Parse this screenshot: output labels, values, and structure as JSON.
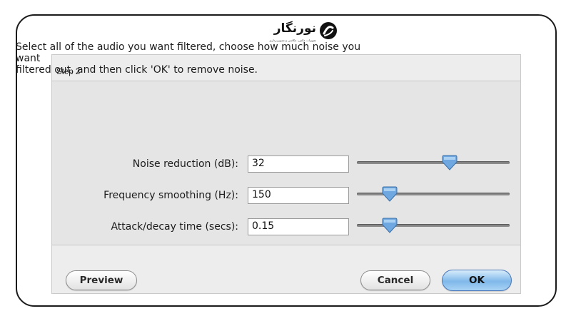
{
  "logo": {
    "text": "نورنگار",
    "subtitle": "تجهیزات عکس، عکاسی و تصویربرداری"
  },
  "dialog": {
    "step_label": "Step 2",
    "instructions": {
      "line1": "Select all of the audio you want filtered, choose how much noise you",
      "line2": "want",
      "line3": "filtered out, and then click 'OK' to remove noise."
    },
    "controls": [
      {
        "label": "Noise reduction (dB):",
        "value": "32",
        "slider_fraction": 0.62
      },
      {
        "label": "Frequency smoothing (Hz):",
        "value": "150",
        "slider_fraction": 0.18
      },
      {
        "label": "Attack/decay time (secs):",
        "value": "0.15",
        "slider_fraction": 0.18
      }
    ],
    "buttons": {
      "preview": "Preview",
      "cancel": "Cancel",
      "ok": "OK"
    }
  },
  "colors": {
    "dialog_bg": "#ededed",
    "panel_bg": "#e5e5e5",
    "thumb_blue": "#6fa8e0",
    "ok_blue": "#7fb8ea"
  },
  "icons": [
    "noorangar-logo-icon",
    "slider-thumb-icon"
  ]
}
